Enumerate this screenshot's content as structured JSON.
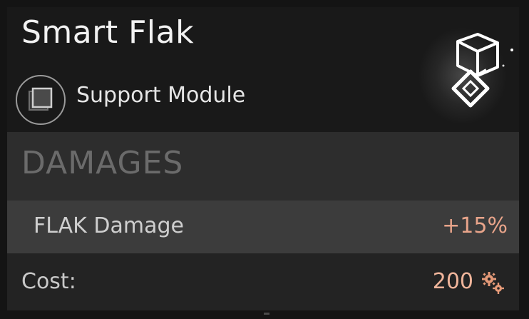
{
  "card": {
    "title": "Smart Flak",
    "module_type": "Support Module",
    "type_icon": "stacked-squares-icon",
    "module_icon": "cube-chip-icon"
  },
  "damages": {
    "heading": "DAMAGES",
    "stats": [
      {
        "label": "FLAK Damage",
        "value": "+15%"
      }
    ]
  },
  "cost": {
    "label": "Cost:",
    "value": "200",
    "currency_icon": "gears-icon"
  },
  "colors": {
    "positive_value": "#e8a48a",
    "cost_value": "#f0b59b",
    "heading": "#6b6b6b"
  }
}
